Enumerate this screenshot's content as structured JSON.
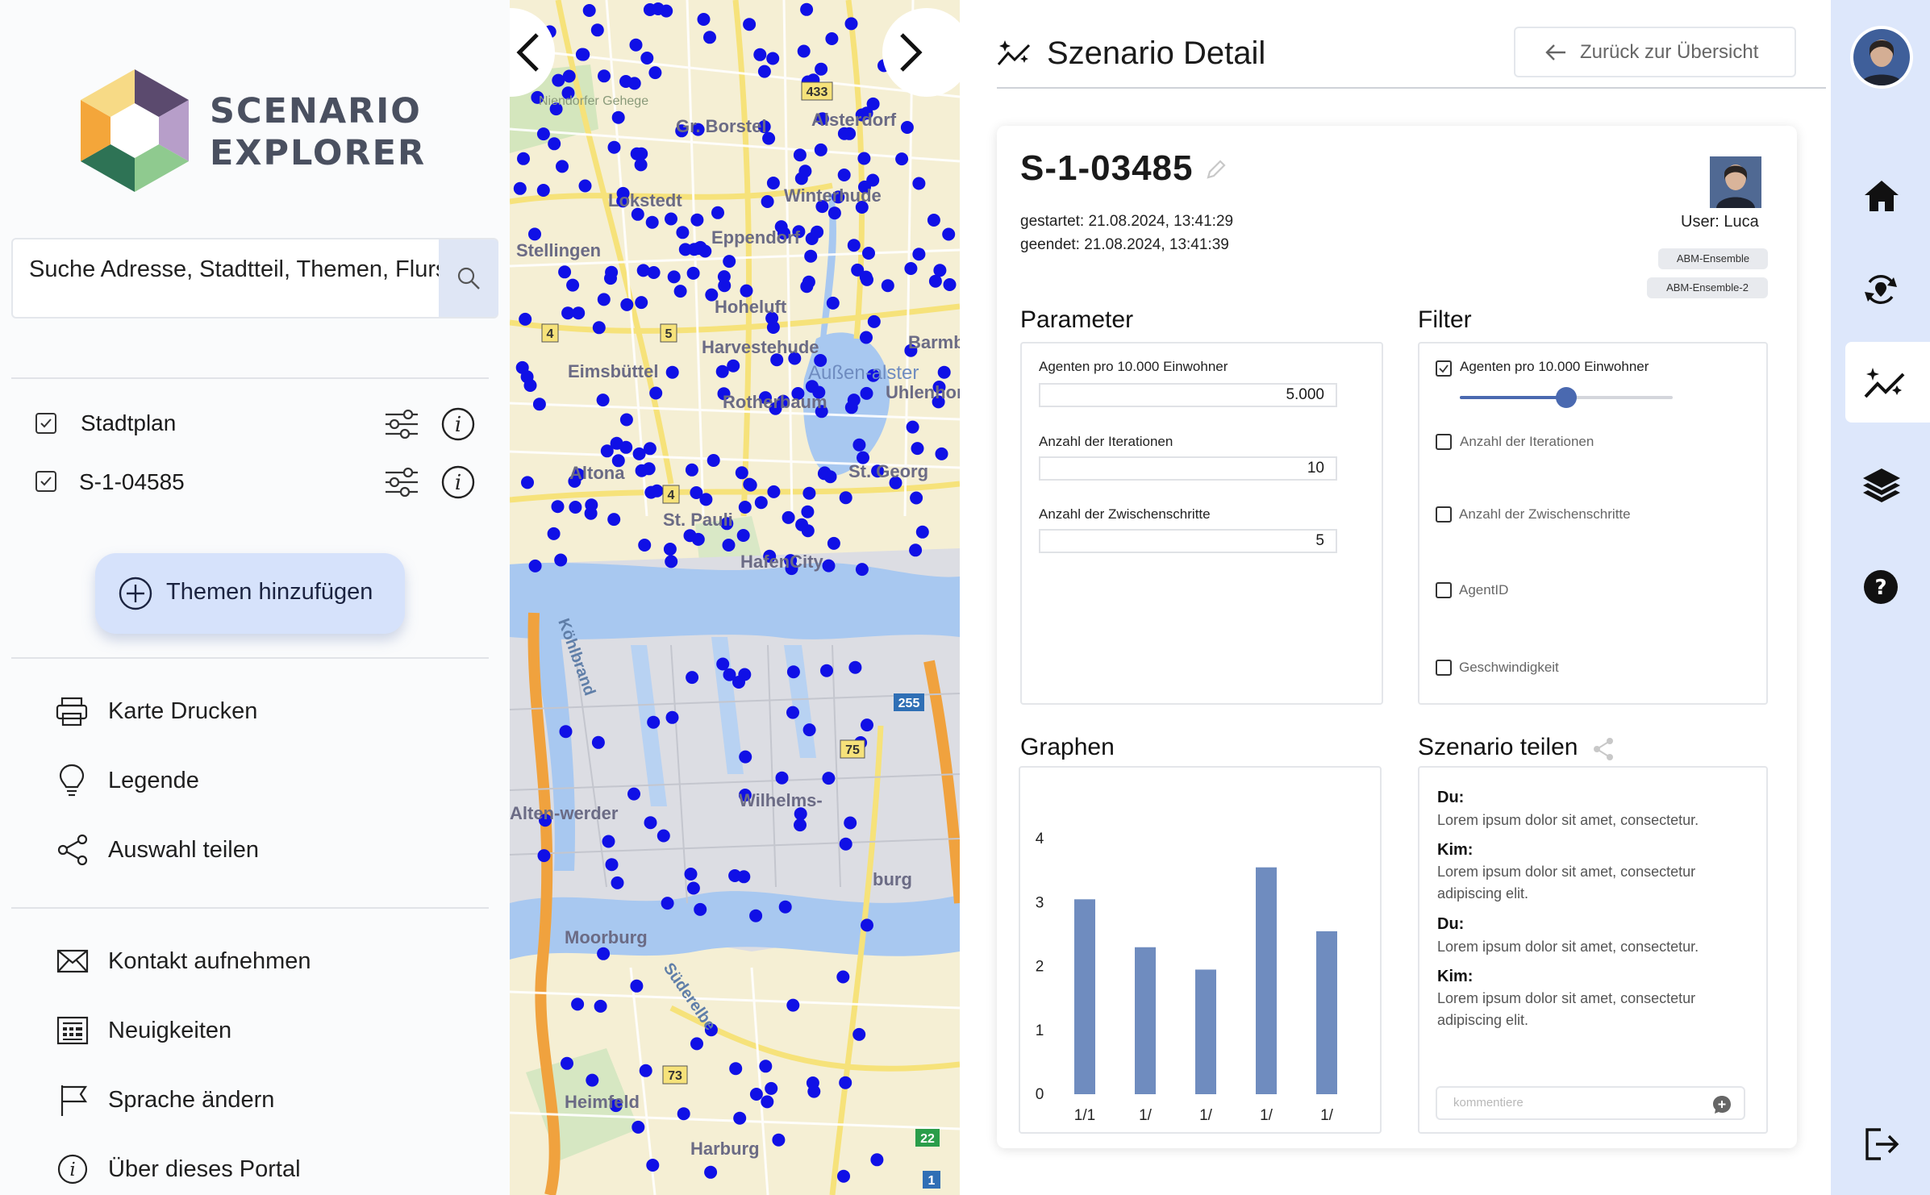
{
  "app": {
    "logo_line1": "SCENARIO",
    "logo_line2": "EXPLORER"
  },
  "search": {
    "value": "Suche Adresse, Stadtteil, Themen, Flurs"
  },
  "layers": [
    {
      "label": "Stadtplan",
      "checked": true
    },
    {
      "label": "S-1-04585",
      "checked": true
    }
  ],
  "add_topics_label": "Themen hinzufügen",
  "menu": {
    "print": "Karte Drucken",
    "legend": "Legende",
    "share": "Auswahl teilen",
    "contact": "Kontakt aufnehmen",
    "news": "Neuigkeiten",
    "language": "Sprache ändern",
    "about": "Über dieses Portal"
  },
  "map": {
    "place_labels": [
      "Gr. Borstel",
      "Alsterdorf",
      "Lokstedt",
      "Winterhude",
      "Stellingen",
      "Eppendorf",
      "Hoheluft",
      "Harvestehude",
      "Eimsbüttel",
      "Rotherbaum",
      "Uhlenhorst",
      "Altona",
      "St. Georg",
      "St. Pauli",
      "HafenCity",
      "Wilhelms-",
      "Moorburg",
      "Heimfeld",
      "Harburg",
      "Alten-werder",
      "burg",
      "Barmbek",
      "Niendorfer Gehege",
      "Köhlbrand",
      "Süderelbe",
      "Außen-alster"
    ],
    "road_numbers": [
      "433",
      "4",
      "5",
      "4",
      "75",
      "255",
      "73",
      "22",
      "1"
    ]
  },
  "detail": {
    "page_title": "Szenario Detail",
    "back_label": "Zurück zur Übersicht",
    "scenario_id": "S-1-03485",
    "started": "gestartet: 21.08.2024, 13:41:29",
    "ended": "geendet: 21.08.2024, 13:41:39",
    "user": "User: Luca",
    "badges": [
      "ABM-Ensemble",
      "ABM-Ensemble-2"
    ],
    "parameter_title": "Parameter",
    "parameters": [
      {
        "label": "Agenten pro 10.000 Einwohner",
        "value": "5.000"
      },
      {
        "label": "Anzahl der Iterationen",
        "value": "10"
      },
      {
        "label": "Anzahl der Zwischenschritte",
        "value": "5"
      }
    ],
    "filter_title": "Filter",
    "filters": [
      {
        "label": "Agenten pro 10.000 Einwohner",
        "checked": true,
        "slider_value": 0.5
      },
      {
        "label": "Anzahl der Iterationen",
        "checked": false
      },
      {
        "label": "Anzahl der Zwischenschritte",
        "checked": false
      },
      {
        "label": "AgentID",
        "checked": false
      },
      {
        "label": "Geschwindigkeit",
        "checked": false
      }
    ],
    "graphs_title": "Graphen",
    "share_title": "Szenario teilen",
    "chat": [
      {
        "name": "Du:",
        "text": "Lorem ipsum dolor sit amet, consectetur."
      },
      {
        "name": "Kim:",
        "text": "Lorem ipsum dolor sit amet, consectetur adipiscing elit."
      },
      {
        "name": "Du:",
        "text": "Lorem ipsum dolor sit amet, consectetur."
      },
      {
        "name": "Kim:",
        "text": "Lorem ipsum dolor sit amet, consectetur adipiscing elit."
      }
    ],
    "comment_placeholder": "kommentiere"
  },
  "chart_data": {
    "type": "bar",
    "categories": [
      "1/1",
      "1/",
      "1/",
      "1/",
      "1/"
    ],
    "values": [
      3.05,
      2.3,
      1.95,
      3.55,
      2.55
    ],
    "yticks": [
      "0",
      "1",
      "2",
      "3",
      "4"
    ],
    "ylim": [
      0,
      4
    ],
    "color": "#6f8cbf",
    "grid": false
  },
  "colors": {
    "accent": "#dde7fb",
    "bar": "#6f8cbf",
    "map_point": "#1010e6",
    "slider": "#4a69b0"
  },
  "rightbar": {
    "icons": [
      "home-icon",
      "scenario-cycle-icon",
      "analytics-icon",
      "layers-icon",
      "help-icon",
      "logout-icon"
    ],
    "active": "analytics-icon"
  }
}
